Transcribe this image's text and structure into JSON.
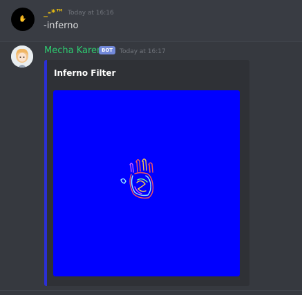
{
  "messages": [
    {
      "username": "_-*™",
      "timestamp": "Today at 16:16",
      "text": "-inferno"
    },
    {
      "username": "Mecha Karen",
      "badge": "BOT",
      "timestamp": "Today at 16:17",
      "embed": {
        "title": "Inferno Filter",
        "accent_color": "#2b2fd6",
        "image_background": "#0000ff"
      }
    }
  ],
  "colors": {
    "user1_name": "#f1c40f",
    "bot_name": "#2ecc71",
    "badge": "#7289da",
    "background": "#36393f"
  }
}
